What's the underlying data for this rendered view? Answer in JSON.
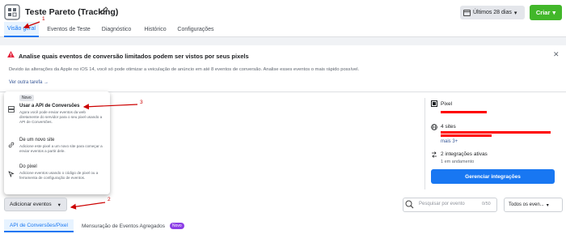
{
  "header": {
    "title": "Teste Pareto (Tracking)",
    "date_range": "Últimos 28 dias",
    "create_label": "Criar"
  },
  "tabs": [
    {
      "label": "Visão geral"
    },
    {
      "label": "Eventos de Teste"
    },
    {
      "label": "Diagnóstico"
    },
    {
      "label": "Histórico"
    },
    {
      "label": "Configurações"
    }
  ],
  "warning": {
    "title": "Analise quais eventos de conversão limitados podem ser vistos por seus pixels",
    "body": "Devido às alterações da Apple no iOS 14, você só pode otimizar a veiculação de anúncio em até 8 eventos de conversão. Analise esses eventos o mais rápido possível.",
    "link": "Ver outra tarefa →"
  },
  "dropdown": {
    "badge": "Novo",
    "options": [
      {
        "title": "Usar a API de Conversões",
        "desc": "Agora você pode enviar eventos da web diretamente do servidor para o seu pixel usando a API de Conversões."
      },
      {
        "title": "De um novo site",
        "desc": "Adicione este pixel a um novo site para começar a enviar eventos a partir dele."
      },
      {
        "title": "Do pixel",
        "desc": "Adicione eventos usando o código de pixel ou a ferramenta de configuração de eventos."
      }
    ]
  },
  "right_panel": {
    "pixel_label": "Pixel",
    "sites_label": "4 sites",
    "more_link": "mais 3+",
    "integrations_label": "2 integrações ativas",
    "integrations_sub": "1 em andamento",
    "manage_button": "Gerenciar integrações"
  },
  "controls": {
    "add_events": "Adicionar eventos",
    "search_placeholder": "Pesquisar por evento",
    "search_count": "0/50",
    "events_filter": "Todos os even..."
  },
  "bottom_tabs": [
    {
      "label": "API de Conversões/Pixel"
    },
    {
      "label": "Mensuração de Eventos Agregados"
    }
  ],
  "bottom_badge": "Novo",
  "annotations": [
    "1",
    "2",
    "3"
  ],
  "colors": {
    "accent": "#1877f2",
    "create": "#42b72a",
    "warning": "#e4253e",
    "annotation": "#cc0000",
    "badge_new": "#8c3ee6"
  }
}
